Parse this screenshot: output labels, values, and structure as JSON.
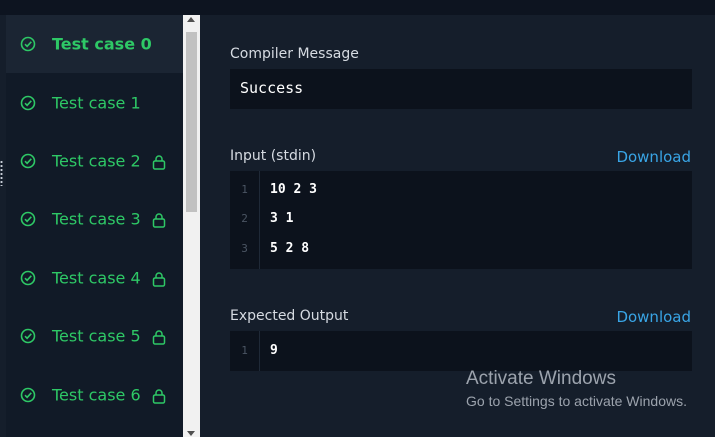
{
  "test_cases": [
    {
      "label": "Test case 0",
      "passed": true,
      "locked": false,
      "active": true
    },
    {
      "label": "Test case 1",
      "passed": true,
      "locked": false,
      "active": false
    },
    {
      "label": "Test case 2",
      "passed": true,
      "locked": true,
      "active": false
    },
    {
      "label": "Test case 3",
      "passed": true,
      "locked": true,
      "active": false
    },
    {
      "label": "Test case 4",
      "passed": true,
      "locked": true,
      "active": false
    },
    {
      "label": "Test case 5",
      "passed": true,
      "locked": true,
      "active": false
    },
    {
      "label": "Test case 6",
      "passed": true,
      "locked": true,
      "active": false
    }
  ],
  "compiler": {
    "heading": "Compiler Message",
    "message": "Success"
  },
  "input": {
    "heading": "Input (stdin)",
    "download_label": "Download",
    "lines": [
      {
        "num": "1",
        "text": "10 2 3"
      },
      {
        "num": "2",
        "text": "3 1"
      },
      {
        "num": "3",
        "text": "5 2 8"
      }
    ]
  },
  "expected": {
    "heading": "Expected Output",
    "download_label": "Download",
    "lines": [
      {
        "num": "1",
        "text": "9"
      }
    ]
  },
  "watermark": {
    "title": "Activate Windows",
    "subtitle": "Go to Settings to activate Windows."
  },
  "colors": {
    "accent_green": "#2ec866",
    "link_blue": "#39a5e6",
    "panel_bg": "#151e2b"
  }
}
